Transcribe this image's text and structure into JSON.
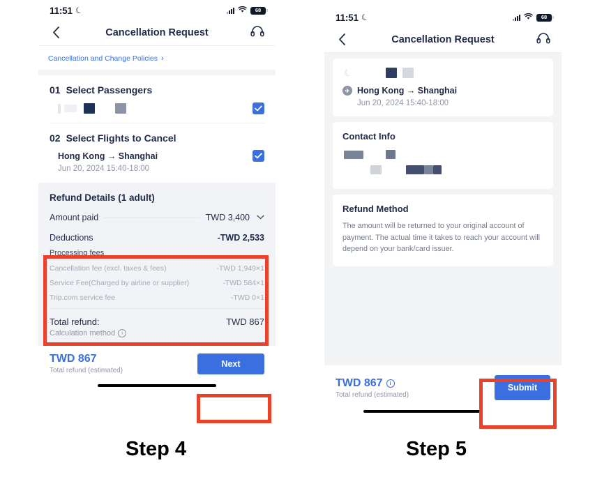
{
  "status_bar": {
    "time": "11:51",
    "moon_icon": "crescent-moon-icon",
    "battery_level": "68",
    "signal_icon": "signal-bars-icon",
    "wifi_icon": "wifi-icon"
  },
  "nav": {
    "back_icon": "chevron-left-icon",
    "title": "Cancellation Request",
    "support_icon": "headset-icon"
  },
  "left_screen": {
    "policy_link": {
      "label": "Cancellation and Change Policies",
      "chevron": "›"
    },
    "section_1": {
      "number": "01",
      "title": "Select Passengers",
      "checkbox_checked": true
    },
    "section_2": {
      "number": "02",
      "title": "Select Flights to Cancel",
      "flight": "Hong Kong → Shanghai",
      "date": "Jun 20, 2024  15:40-18:00",
      "checkbox_checked": true
    },
    "refund_details": {
      "title": "Refund Details (1 adult)",
      "amount_paid_label": "Amount paid",
      "amount_paid_value": "TWD 3,400",
      "chevron": "⌄",
      "deductions_label": "Deductions",
      "deductions_value": "-TWD 2,533",
      "processing_fees_label": "Processing fees",
      "fees": [
        {
          "label": "Cancellation fee (excl. taxes & fees)",
          "value": "-TWD 1,949×1"
        },
        {
          "label": "Service Fee(Charged by airline or supplier)",
          "value": "-TWD 584×1"
        },
        {
          "label": "Trip.com service fee",
          "value": "-TWD 0×1"
        }
      ],
      "total_refund_label": "Total refund:",
      "total_refund_value": "TWD 867",
      "calculation_method_label": "Calculation method",
      "info_icon": "info-icon"
    },
    "bottom_bar": {
      "price": "TWD 867",
      "sub_label": "Total refund (estimated)",
      "cta_label": "Next"
    }
  },
  "right_screen": {
    "flight_card": {
      "moon_icon": "crescent-moon-icon",
      "plane_icon": "plane-icon",
      "flight": "Hong Kong → Shanghai",
      "date": "Jun 20, 2024  15:40-18:00"
    },
    "contact_info": {
      "title": "Contact Info"
    },
    "refund_method": {
      "title": "Refund Method",
      "description": "The amount will be returned to your original account of payment. The actual time it takes to reach your account will depend on your bank/card issuer."
    },
    "bottom_bar": {
      "price": "TWD 867",
      "info_icon": "info-icon",
      "sub_label": "Total refund (estimated)",
      "cta_label": "Submit"
    }
  },
  "annotations": {
    "step_4_label": "Step 4",
    "step_5_label": "Step 5",
    "highlight_color": "#e8432a"
  },
  "colors": {
    "accent_blue": "#3b6fe0",
    "dark_navy": "#1e2a47",
    "muted_gray": "#9097a6",
    "panel_gray": "#f2f3f6",
    "page_bg": "#f3f4f6"
  }
}
